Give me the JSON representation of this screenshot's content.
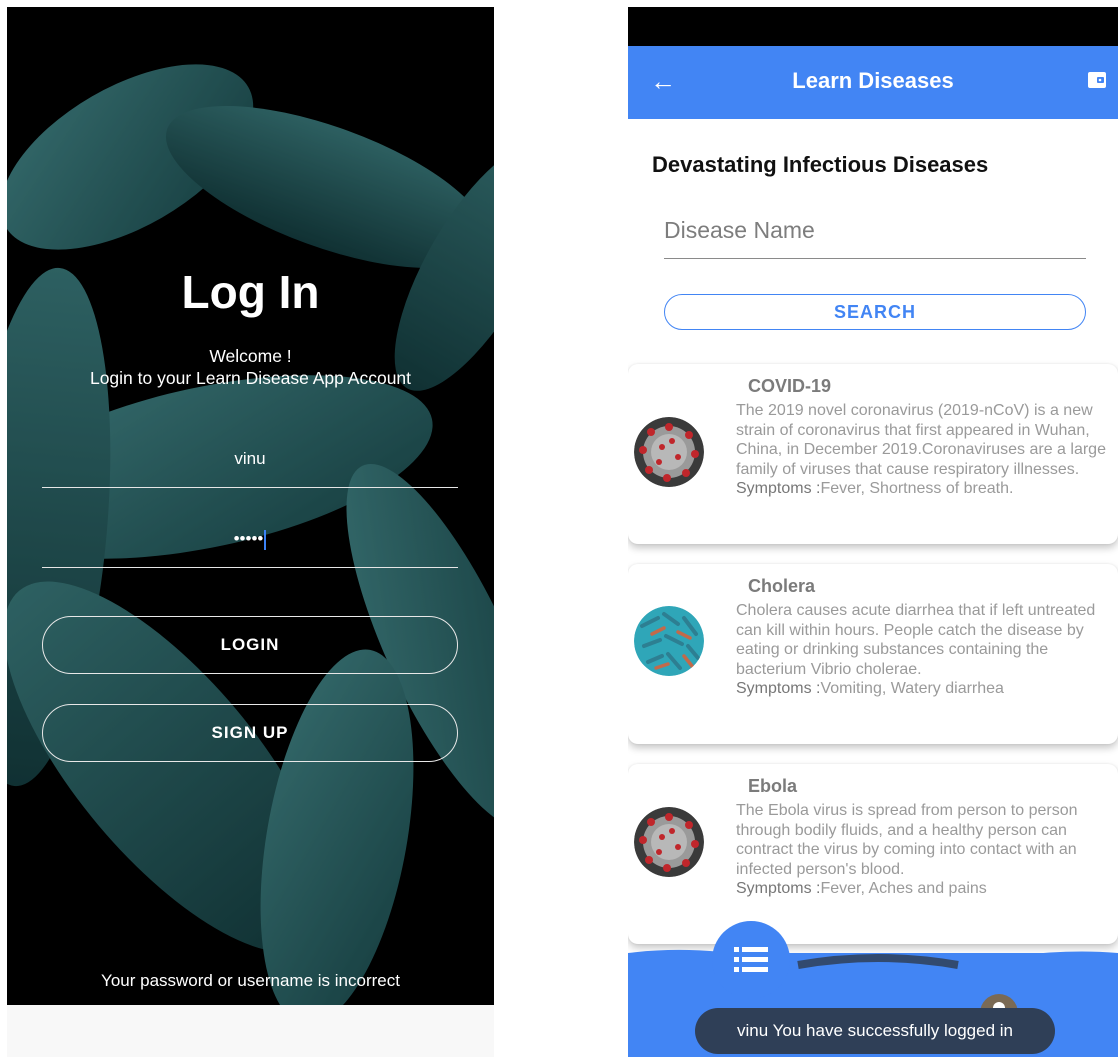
{
  "login_screen": {
    "title": "Log In",
    "welcome_line1": "Welcome !",
    "welcome_line2": "Login to your Learn Disease App Account",
    "username_value": "vinu",
    "password_value": "•••••",
    "login_label": "LOGIN",
    "signup_label": "SIGN UP",
    "error_message": "Your password or username is incorrect"
  },
  "diseases_screen": {
    "appbar": {
      "title": "Learn Diseases",
      "back_icon": "arrow-back-icon",
      "action_icon": "wallet-icon"
    },
    "heading": "Devastating Infectious Diseases",
    "search": {
      "placeholder": "Disease Name",
      "button_label": "SEARCH"
    },
    "symptoms_label": "Symptoms :",
    "diseases": [
      {
        "name": "COVID-19",
        "description": "The 2019 novel coronavirus (2019-nCoV) is a new strain of coronavirus that first appeared in Wuhan, China, in December 2019.Coronaviruses are a large family of viruses that cause respiratory illnesses.",
        "symptoms": "Fever, Shortness of breath."
      },
      {
        "name": "Cholera",
        "description": "Cholera causes acute diarrhea that if left untreated can kill within hours. People catch the disease by eating or drinking substances containing the bacterium Vibrio cholerae.",
        "symptoms": "Vomiting, Watery diarrhea"
      },
      {
        "name": "Ebola",
        "description": "The Ebola virus is spread from person to person through bodily fluids, and a healthy person can contract the virus by coming into contact with an infected person's blood.",
        "symptoms": "Fever, Aches and pains"
      }
    ],
    "bottom_nav": {
      "left_icon": "list-icon",
      "right_icon": "person-icon"
    },
    "toast": "vinu You have successfully logged in"
  },
  "colors": {
    "primary": "#4285f4",
    "toast": "#2f3f57",
    "bacteria": "#3f8a8e"
  }
}
